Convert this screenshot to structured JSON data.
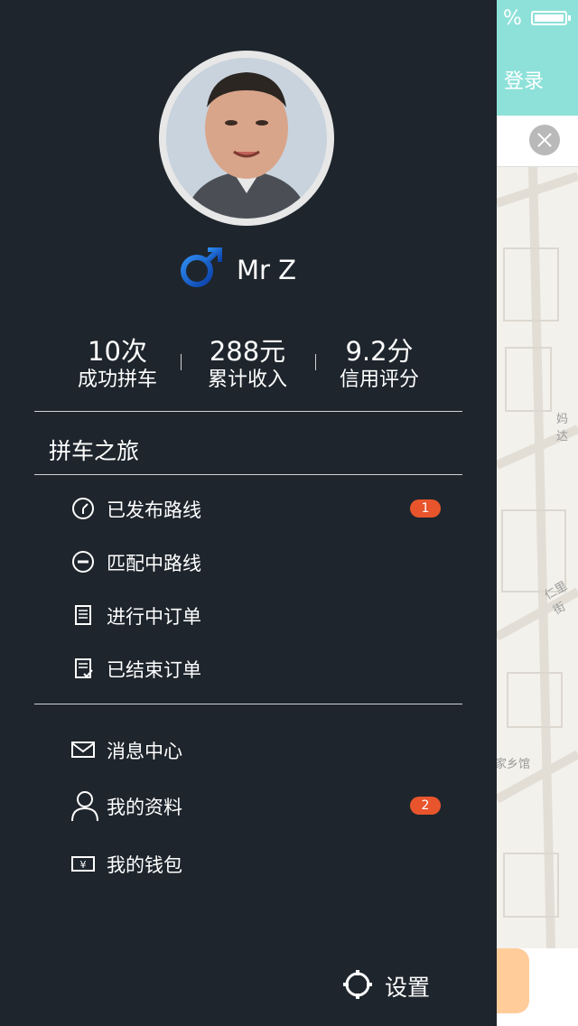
{
  "status": {
    "percent_glyph": "%"
  },
  "background_app": {
    "login_label": "登录",
    "map_labels": [
      "妈达",
      "仁里街",
      "家乡馆"
    ],
    "colors": {
      "header": "#8ee1d9",
      "accent_orange": "#ffcc9a"
    }
  },
  "profile": {
    "name": "Mr Z",
    "gender_icon": "male-symbol-icon",
    "stats": [
      {
        "value": "10次",
        "label": "成功拼车"
      },
      {
        "value": "288元",
        "label": "累计收入"
      },
      {
        "value": "9.2分",
        "label": "信用评分"
      }
    ]
  },
  "section": {
    "title": "拼车之旅"
  },
  "trip_menu": [
    {
      "label": "已发布路线",
      "icon": "clock-icon",
      "badge": "1"
    },
    {
      "label": "匹配中路线",
      "icon": "minus-circle-icon",
      "badge": ""
    },
    {
      "label": "进行中订单",
      "icon": "document-icon",
      "badge": ""
    },
    {
      "label": "已结束订单",
      "icon": "document-check-icon",
      "badge": ""
    }
  ],
  "account_menu": [
    {
      "label": "消息中心",
      "icon": "envelope-icon",
      "badge": ""
    },
    {
      "label": "我的资料",
      "icon": "user-icon",
      "badge": "2"
    },
    {
      "label": "我的钱包",
      "icon": "wallet-icon",
      "badge": ""
    }
  ],
  "settings": {
    "label": "设置",
    "icon": "gear-icon"
  },
  "colors": {
    "drawer_bg": "#1e252c",
    "badge": "#e8552c",
    "gender_blue": "#1e6fd9"
  }
}
